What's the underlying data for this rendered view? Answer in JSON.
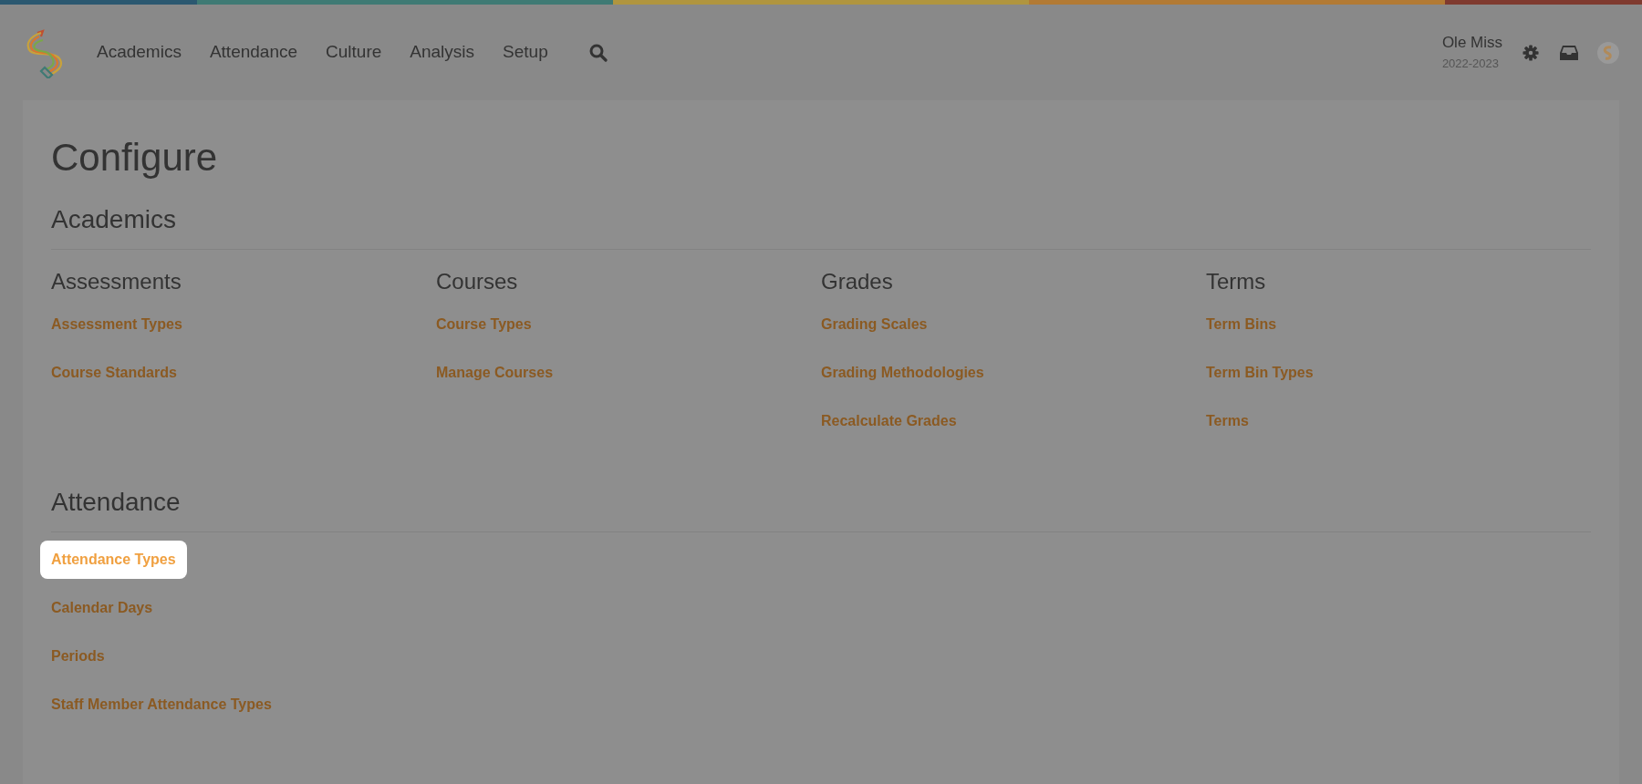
{
  "nav": {
    "items": [
      {
        "label": "Academics"
      },
      {
        "label": "Attendance"
      },
      {
        "label": "Culture"
      },
      {
        "label": "Analysis"
      },
      {
        "label": "Setup"
      }
    ],
    "school": "Ole Miss",
    "year": "2022-2023"
  },
  "page": {
    "title": "Configure",
    "sections": [
      {
        "title": "Academics",
        "groups": [
          {
            "title": "Assessments",
            "links": [
              {
                "label": "Assessment Types",
                "highlighted": false
              },
              {
                "label": "Course Standards",
                "highlighted": false
              }
            ]
          },
          {
            "title": "Courses",
            "links": [
              {
                "label": "Course Types",
                "highlighted": false
              },
              {
                "label": "Manage Courses",
                "highlighted": false
              }
            ]
          },
          {
            "title": "Grades",
            "links": [
              {
                "label": "Grading Scales",
                "highlighted": false
              },
              {
                "label": "Grading Methodologies",
                "highlighted": false
              },
              {
                "label": "Recalculate Grades",
                "highlighted": false
              }
            ]
          },
          {
            "title": "Terms",
            "links": [
              {
                "label": "Term Bins",
                "highlighted": false
              },
              {
                "label": "Term Bin Types",
                "highlighted": false
              },
              {
                "label": "Terms",
                "highlighted": false
              }
            ]
          }
        ]
      },
      {
        "title": "Attendance",
        "groups": [
          {
            "links": [
              {
                "label": "Attendance Types",
                "highlighted": true
              },
              {
                "label": "Calendar Days",
                "highlighted": false
              },
              {
                "label": "Periods",
                "highlighted": false
              },
              {
                "label": "Staff Member Attendance Types",
                "highlighted": false
              }
            ]
          }
        ]
      }
    ]
  }
}
